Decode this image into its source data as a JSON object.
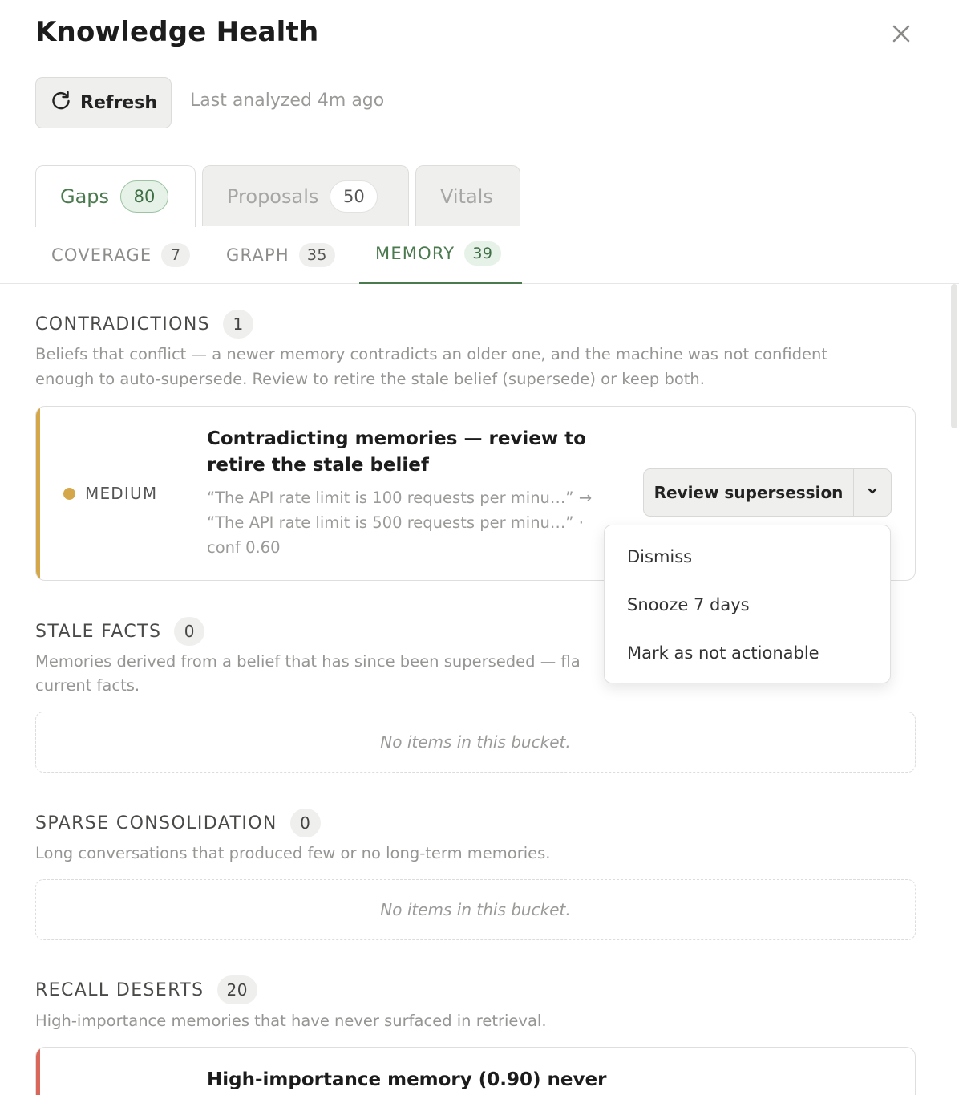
{
  "header": {
    "title": "Knowledge Health",
    "refresh_label": "Refresh",
    "last_analyzed": "Last analyzed 4m ago",
    "close_icon": "close-icon",
    "refresh_icon": "refresh-icon"
  },
  "tabs": [
    {
      "label": "Gaps",
      "count": "80",
      "active": true
    },
    {
      "label": "Proposals",
      "count": "50",
      "active": false
    },
    {
      "label": "Vitals",
      "active": false
    }
  ],
  "subtabs": [
    {
      "label": "COVERAGE",
      "count": "7",
      "active": false
    },
    {
      "label": "GRAPH",
      "count": "35",
      "active": false
    },
    {
      "label": "MEMORY",
      "count": "39",
      "active": true
    }
  ],
  "sections": {
    "contradictions": {
      "title": "CONTRADICTIONS",
      "count": "1",
      "description": "Beliefs that conflict — a newer memory contradicts an older one, and the machine was not confident enough to auto-supersede. Review to retire the stale belief (supersede) or keep both.",
      "card": {
        "severity": "MEDIUM",
        "severity_color": "#d4a84a",
        "title": "Contradicting memories — review to retire the stale belief",
        "detail": "“The API rate limit is 100 requests per minu…” → “The API rate limit is 500 requests per minu…” · conf 0.60",
        "action_label": "Review supersession",
        "menu": [
          "Dismiss",
          "Snooze 7 days",
          "Mark as not actionable"
        ]
      }
    },
    "stale_facts": {
      "title": "STALE FACTS",
      "count": "0",
      "description": "Memories derived from a belief that has since been superseded — fla",
      "description_line2": "current facts.",
      "empty": "No items in this bucket."
    },
    "sparse": {
      "title": "SPARSE CONSOLIDATION",
      "count": "0",
      "description": "Long conversations that produced few or no long-term memories.",
      "empty": "No items in this bucket."
    },
    "recall_deserts": {
      "title": "RECALL DESERTS",
      "count": "20",
      "description": "High-importance memories that have never surfaced in retrieval.",
      "card": {
        "title": "High-importance memory (0.90) never",
        "severity_color": "#d9685a"
      }
    }
  },
  "colors": {
    "accent": "#4b7a4f",
    "medium": "#d4a84a",
    "high": "#d9685a"
  }
}
